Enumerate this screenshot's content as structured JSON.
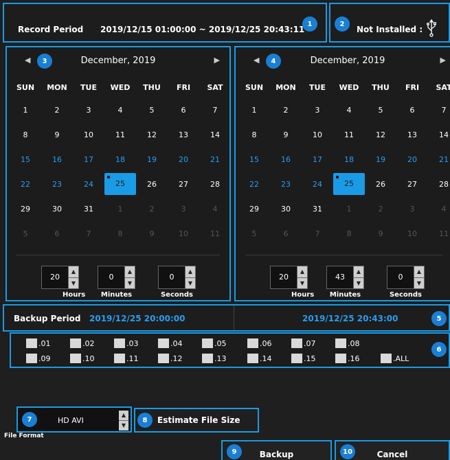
{
  "header": {
    "record_label": "Record Period",
    "record_value": "2019/12/15 01:00:00 ~ 2019/12/25 20:43:11",
    "install_label": "Not Installed :",
    "usb_icon": "usb-icon"
  },
  "badges": [
    "1",
    "2",
    "3",
    "4",
    "5",
    "6",
    "7",
    "8",
    "9",
    "10"
  ],
  "calendar_start": {
    "title": "December, 2019",
    "weekdays": [
      "SUN",
      "MON",
      "TUE",
      "WED",
      "THU",
      "FRI",
      "SAT"
    ],
    "hours": "20",
    "minutes": "0",
    "seconds": "0"
  },
  "calendar_end": {
    "title": "December, 2019",
    "weekdays": [
      "SUN",
      "MON",
      "TUE",
      "WED",
      "THU",
      "FRI",
      "SAT"
    ],
    "hours": "20",
    "minutes": "43",
    "seconds": "0"
  },
  "calendar_weeks": [
    [
      "1",
      "2",
      "3",
      "4",
      "5",
      "6",
      "7"
    ],
    [
      "8",
      "9",
      "10",
      "11",
      "12",
      "13",
      "14"
    ],
    [
      "15",
      "16",
      "17",
      "18",
      "19",
      "20",
      "21"
    ],
    [
      "22",
      "23",
      "24",
      "25",
      "26",
      "27",
      "28"
    ],
    [
      "29",
      "30",
      "31",
      "1",
      "2",
      "3",
      "4"
    ],
    [
      "5",
      "6",
      "7",
      "8",
      "9",
      "10",
      "11"
    ]
  ],
  "selected_day": "25",
  "spin_labels": {
    "hours": "Hours",
    "minutes": "Minutes",
    "seconds": "Seconds"
  },
  "backup": {
    "label": "Backup Period",
    "from": "2019/12/25 20:00:00",
    "to": "2019/12/25 20:43:00"
  },
  "channels": [
    ".01",
    ".02",
    ".03",
    ".04",
    ".05",
    ".06",
    ".07",
    ".08",
    ".09",
    ".10",
    ".11",
    ".12",
    ".13",
    ".14",
    ".15",
    ".16",
    ".ALL"
  ],
  "format": {
    "value": "HD AVI",
    "label": "File Format"
  },
  "estimate_label": "Estimate File Size",
  "backup_button": "Backup",
  "cancel_button": "Cancel",
  "colors": {
    "accent": "#1a9be6",
    "highlight_text": "#2a9cf0"
  }
}
